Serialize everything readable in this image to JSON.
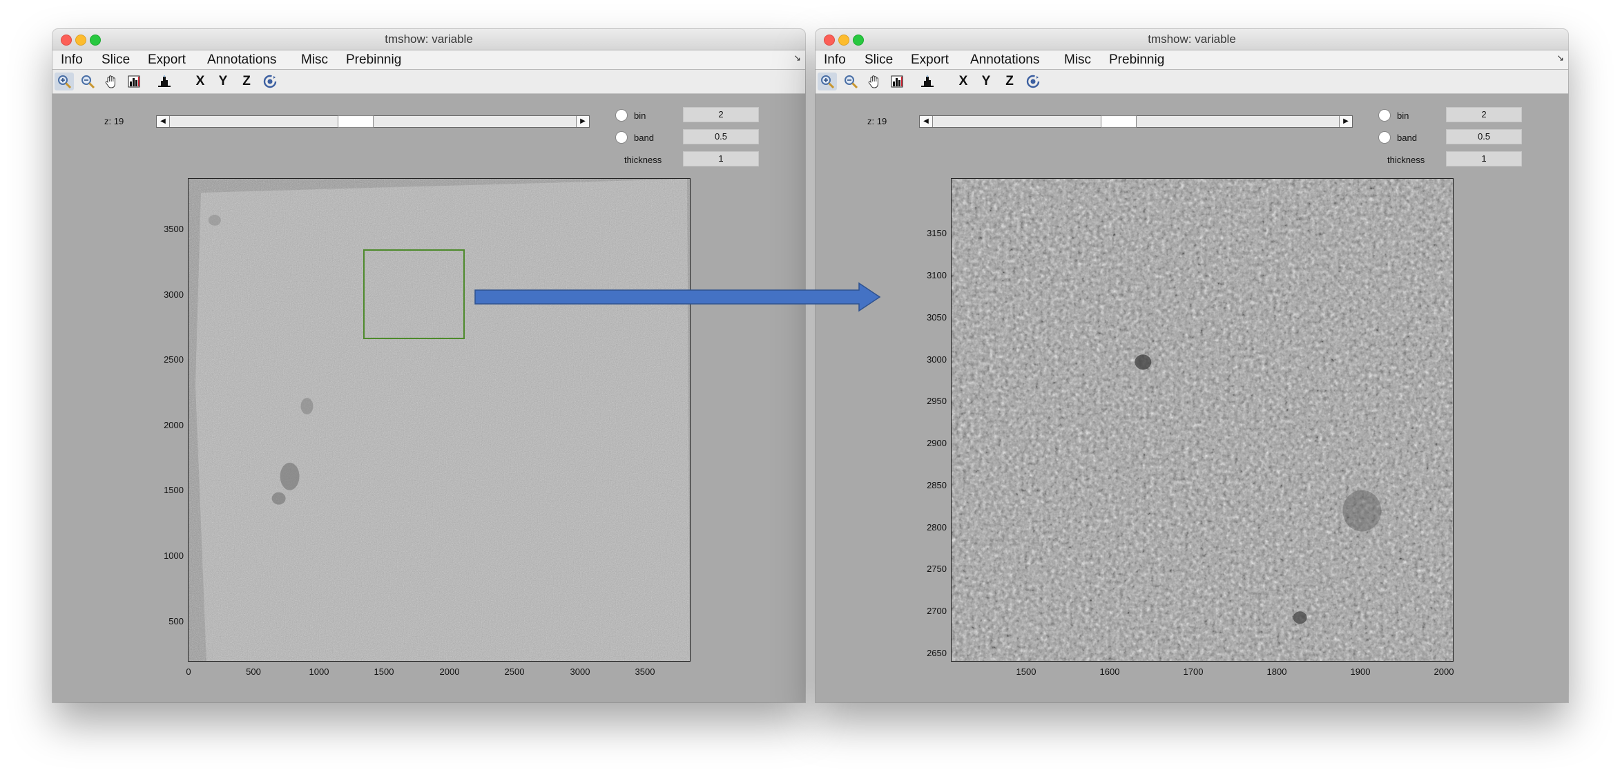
{
  "windows": [
    {
      "title": "tmshow: variable",
      "menu": [
        "Info",
        "Slice",
        "Export",
        "Annotations",
        "Misc",
        "Prebinnig"
      ],
      "toolbar": {
        "tools": [
          "zoom-in-icon",
          "zoom-out-icon",
          "pan-hand-icon",
          "colorbar-icon",
          "histogram-icon"
        ],
        "axis_buttons": [
          "X",
          "Y",
          "Z"
        ],
        "rotate": "rotate-3d-icon"
      },
      "slice": {
        "label": "z: 19",
        "position": 0.5
      },
      "options": {
        "bin": {
          "label": "bin",
          "value": "2"
        },
        "band": {
          "label": "band",
          "value": "0.5"
        },
        "thickness": {
          "label": "thickness",
          "value": "1"
        }
      },
      "image": {
        "y_ticks": [
          "3500",
          "3000",
          "2500",
          "2000",
          "1500",
          "1000",
          "500"
        ],
        "x_ticks": [
          "0",
          "500",
          "1000",
          "1500",
          "2000",
          "2500",
          "3000",
          "3500"
        ]
      }
    },
    {
      "title": "tmshow: variable",
      "menu": [
        "Info",
        "Slice",
        "Export",
        "Annotations",
        "Misc",
        "Prebinnig"
      ],
      "toolbar": {
        "tools": [
          "zoom-in-icon",
          "zoom-out-icon",
          "pan-hand-icon",
          "colorbar-icon",
          "histogram-icon"
        ],
        "axis_buttons": [
          "X",
          "Y",
          "Z"
        ],
        "rotate": "rotate-3d-icon"
      },
      "slice": {
        "label": "z: 19",
        "position": 0.5
      },
      "options": {
        "bin": {
          "label": "bin",
          "value": "2"
        },
        "band": {
          "label": "band",
          "value": "0.5"
        },
        "thickness": {
          "label": "thickness",
          "value": "1"
        }
      },
      "image": {
        "y_ticks": [
          "3150",
          "3100",
          "3050",
          "3000",
          "2950",
          "2900",
          "2850",
          "2800",
          "2750",
          "2700",
          "2650"
        ],
        "x_ticks": [
          "1500",
          "1600",
          "1700",
          "1800",
          "1900",
          "2000"
        ]
      }
    }
  ],
  "colors": {
    "window_bg": "#a9a9a9",
    "zoom_box": "#4d8a2b",
    "arrow": "#4472c4"
  }
}
